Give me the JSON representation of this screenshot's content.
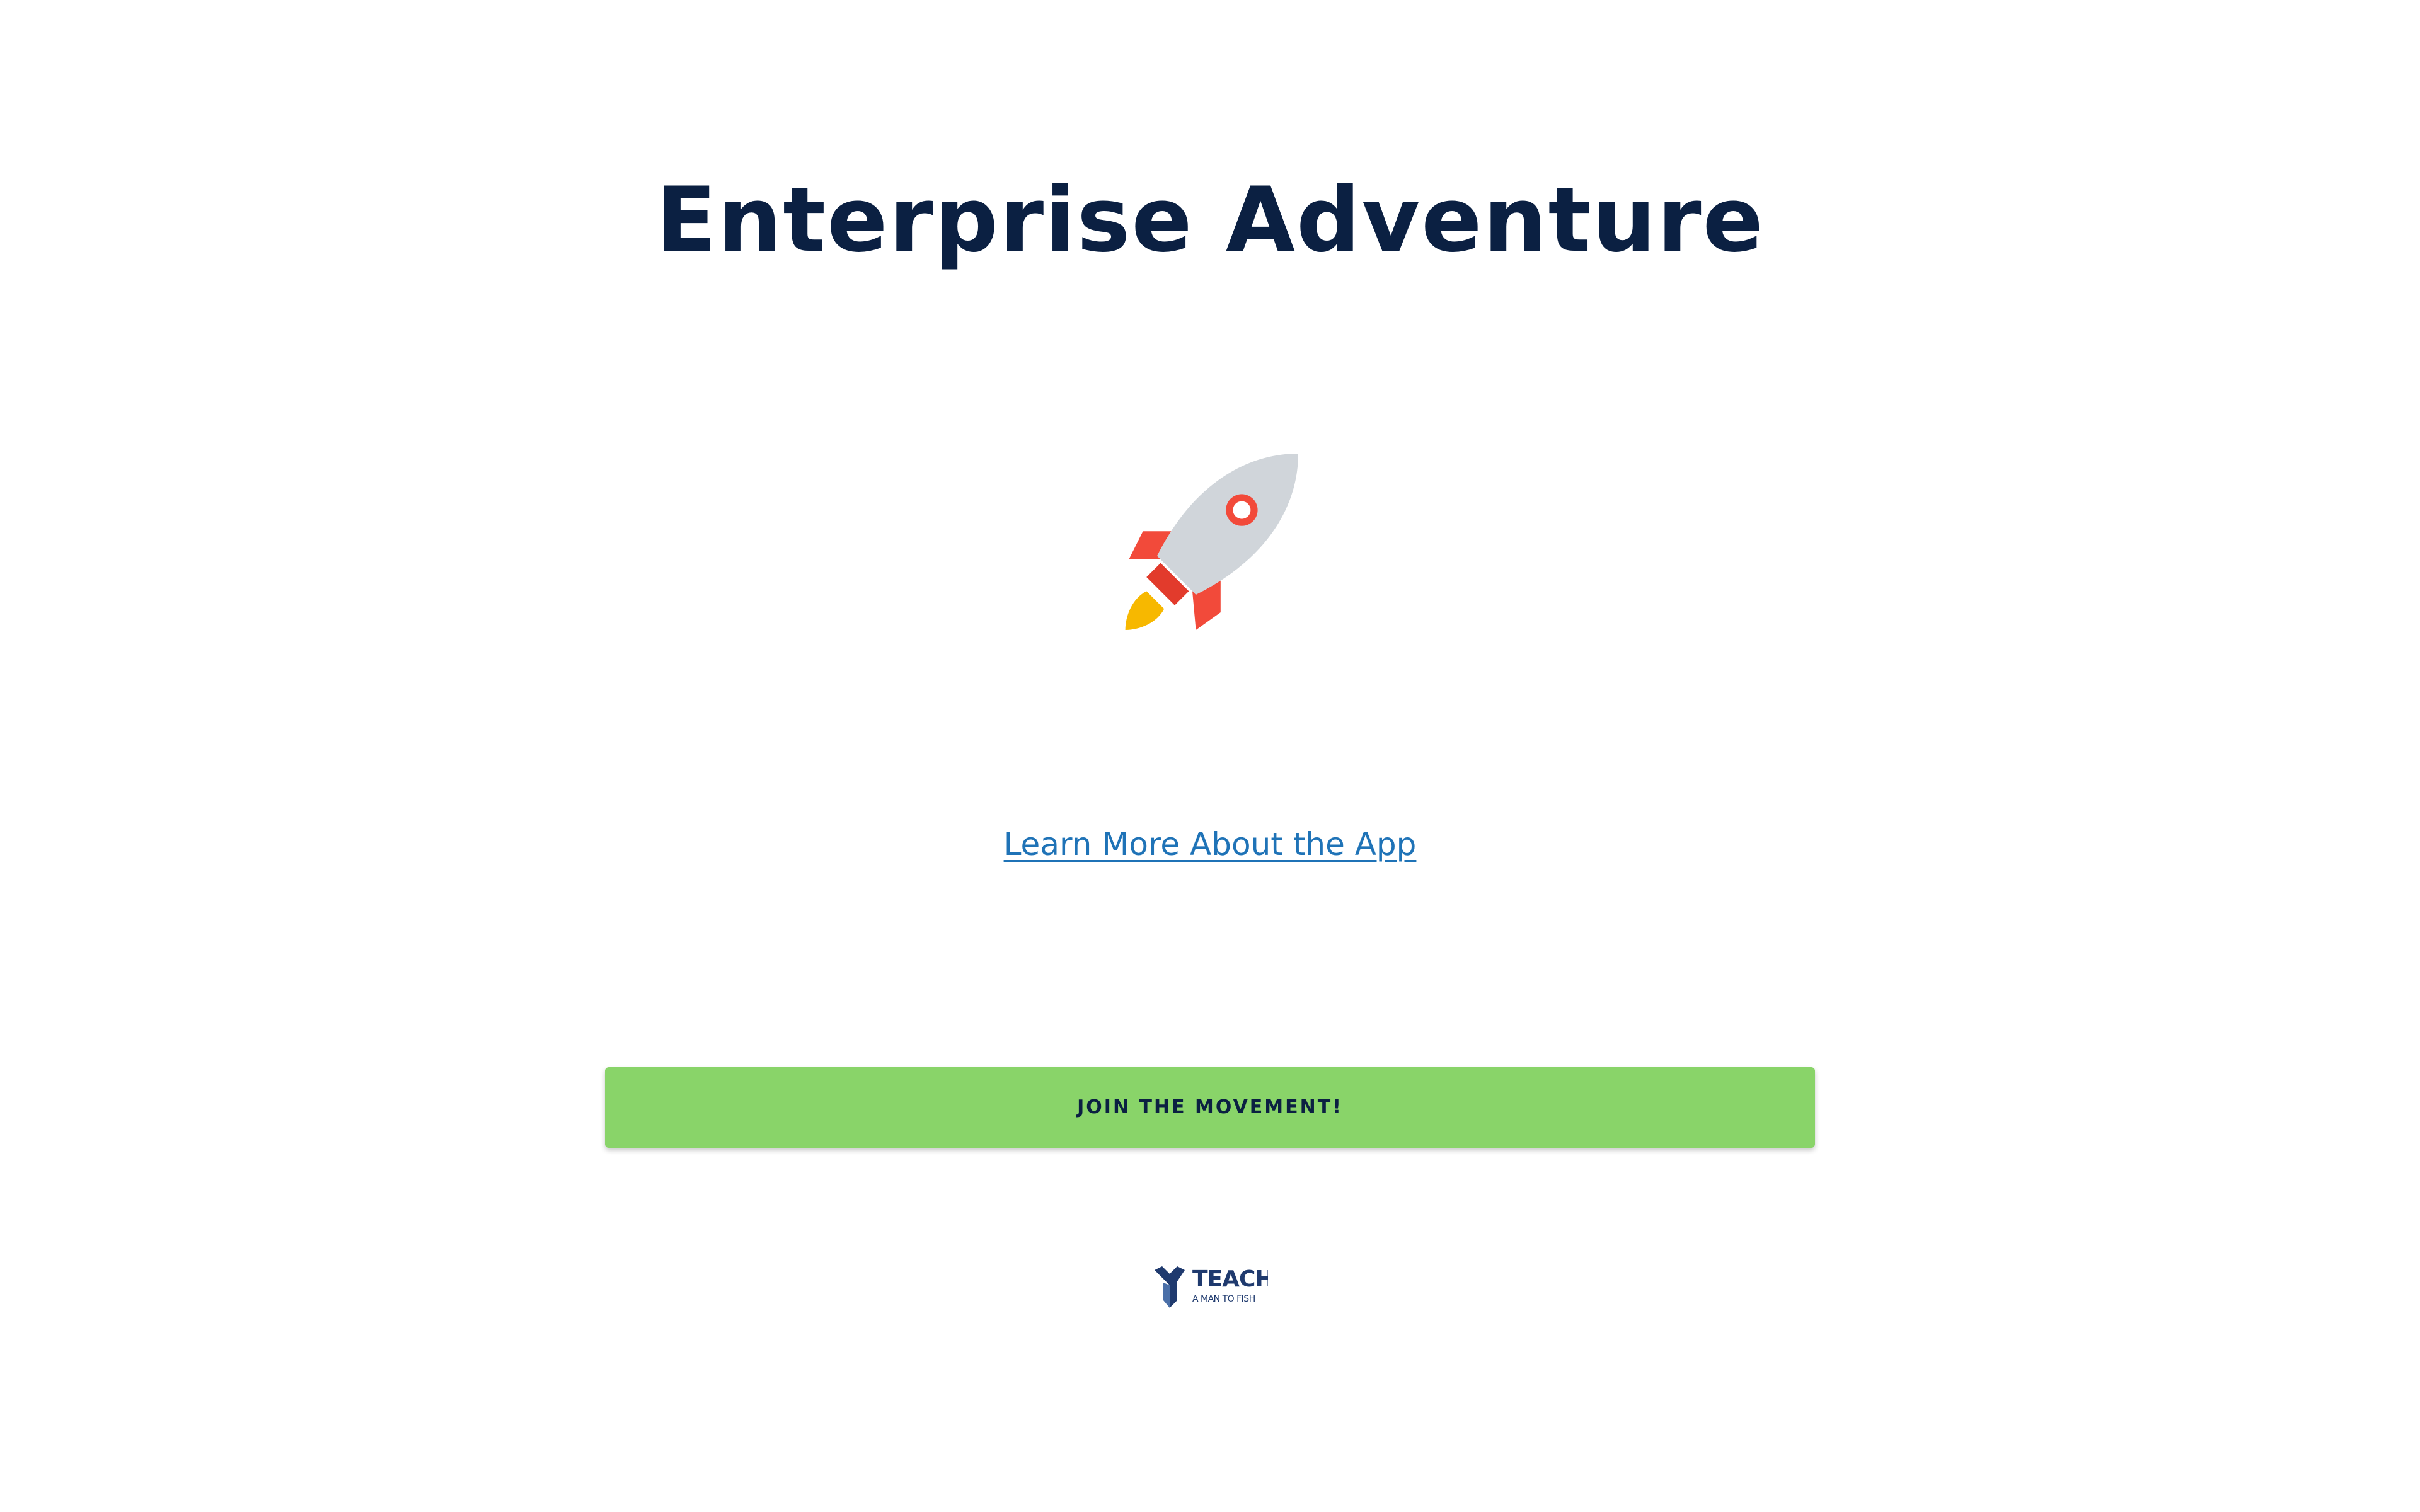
{
  "page": {
    "title": "Enterprise Adventure",
    "learn_more_label": "Learn More About the App",
    "join_button_label": "JOIN THE MOVEMENT!"
  },
  "logo": {
    "main_text": "TEACH",
    "sub_text": "A MAN TO FISH"
  },
  "icons": {
    "rocket": "rocket-icon",
    "logo_mark": "teach-logo-mark-icon"
  },
  "colors": {
    "title": "#0b2042",
    "link": "#1f73b7",
    "button_bg": "#89d469",
    "button_text": "#0b2042",
    "rocket_body": "#d0d5da",
    "rocket_red": "#f24a3a",
    "rocket_flame": "#f7b800",
    "logo_blue": "#1f3a6e"
  }
}
